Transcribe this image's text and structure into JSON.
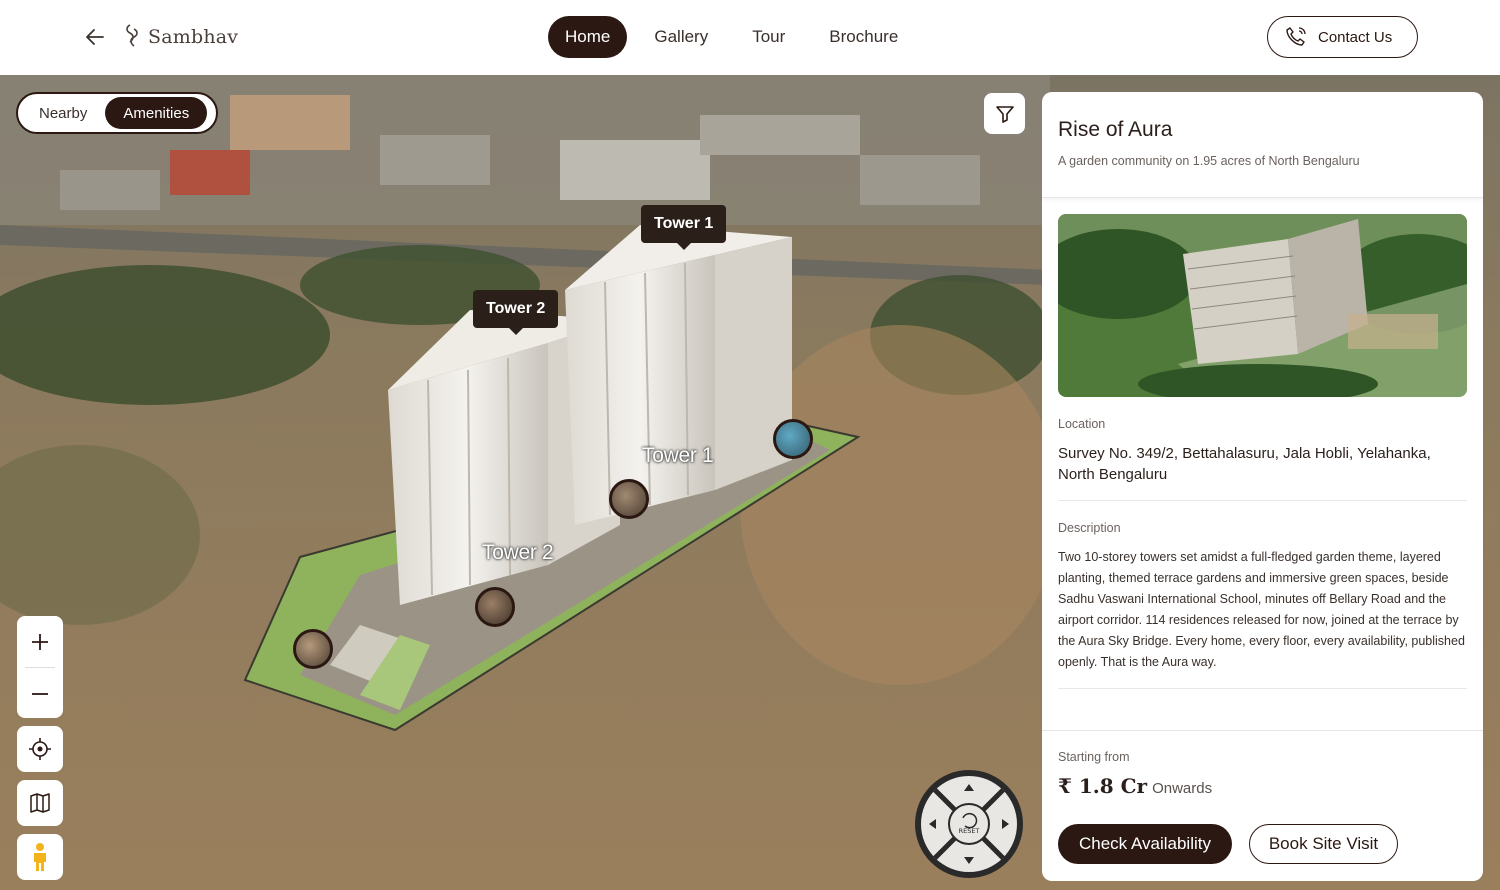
{
  "header": {
    "logo_text": "Sambhav",
    "nav": [
      {
        "label": "Home",
        "active": true
      },
      {
        "label": "Gallery",
        "active": false
      },
      {
        "label": "Tour",
        "active": false
      },
      {
        "label": "Brochure",
        "active": false
      }
    ],
    "contact_label": "Contact Us"
  },
  "map": {
    "toggle": [
      {
        "label": "Nearby",
        "active": false
      },
      {
        "label": "Amenities",
        "active": true
      }
    ],
    "tower_tags": [
      "Tower 1",
      "Tower 2"
    ],
    "ground_labels": [
      "Tower 1",
      "Tower 2"
    ],
    "compass_label": "RESET"
  },
  "panel": {
    "title": "Rise of Aura",
    "subtitle": "A garden community on 1.95 acres of North Bengaluru",
    "location_label": "Location",
    "location": "Survey No. 349/2, Bettahalasuru, Jala Hobli, Yelahanka, North Bengaluru",
    "description_label": "Description",
    "description": "Two 10-storey towers set amidst a full-fledged garden theme, layered planting, themed terrace gardens and immersive green spaces, beside Sadhu Vaswani International School, minutes off Bellary Road and the airport corridor. 114 residences released for now, joined at the terrace by the Aura Sky Bridge. Every home, every floor, every availability, published openly. That is the Aura way.",
    "starting_label": "Starting from",
    "price": "₹ 1.8 Cr",
    "price_suffix": "Onwards",
    "check_label": "Check Availability",
    "visit_label": "Book Site Visit"
  },
  "colors": {
    "accent": "#2b1812",
    "tag_bg": "#2b2019"
  }
}
